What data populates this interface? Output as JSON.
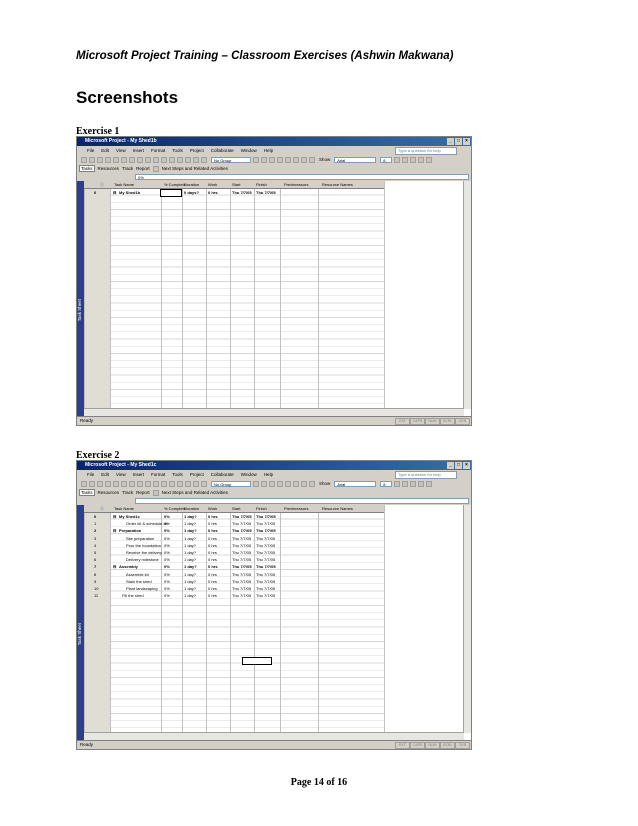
{
  "doc": {
    "header": "Microsoft Project Training – Classroom Exercises (Ashwin Makwana)",
    "heading": "Screenshots",
    "footer": "Page 14 of 16"
  },
  "exercises": [
    {
      "label": "Exercise 1",
      "window_title": "Microsoft Project - My Shed1b",
      "entry_value": "0%",
      "rows": [
        {
          "id": "0",
          "name": "My Shed1b",
          "complete": "0%",
          "duration": "0 days?",
          "work": "0 hrs",
          "start": "Thu 7/7/05",
          "finish": "Thu 7/7/05",
          "bold": true,
          "indent": 0
        }
      ]
    },
    {
      "label": "Exercise 2",
      "window_title": "Microsoft Project - My Shed1c",
      "entry_value": "",
      "rows": [
        {
          "id": "0",
          "name": "My Shed1c",
          "complete": "0%",
          "duration": "1 day?",
          "work": "0 hrs",
          "start": "Thu 7/7/05",
          "finish": "Thu 7/7/05",
          "bold": true,
          "indent": 0
        },
        {
          "id": "1",
          "name": "Order kit & schedule de",
          "complete": "0%",
          "duration": "1 day?",
          "work": "0 hrs",
          "start": "Thu 7/7/05",
          "finish": "Thu 7/7/05",
          "bold": false,
          "indent": 1
        },
        {
          "id": "2",
          "name": "Preparation",
          "complete": "0%",
          "duration": "1 day?",
          "work": "0 hrs",
          "start": "Thu 7/7/05",
          "finish": "Thu 7/7/05",
          "bold": true,
          "indent": 0
        },
        {
          "id": "3",
          "name": "Site preparation",
          "complete": "0%",
          "duration": "1 day?",
          "work": "0 hrs",
          "start": "Thu 7/7/05",
          "finish": "Thu 7/7/05",
          "bold": false,
          "indent": 1
        },
        {
          "id": "4",
          "name": "Pour the foundation",
          "complete": "0%",
          "duration": "1 day?",
          "work": "0 hrs",
          "start": "Thu 7/7/05",
          "finish": "Thu 7/7/05",
          "bold": false,
          "indent": 1
        },
        {
          "id": "5",
          "name": "Receive the delivery",
          "complete": "0%",
          "duration": "1 day?",
          "work": "0 hrs",
          "start": "Thu 7/7/05",
          "finish": "Thu 7/7/05",
          "bold": false,
          "indent": 1
        },
        {
          "id": "6",
          "name": "Delivery milestone",
          "complete": "0%",
          "duration": "1 day?",
          "work": "0 hrs",
          "start": "Thu 7/7/05",
          "finish": "Thu 7/7/05",
          "bold": false,
          "indent": 1
        },
        {
          "id": "7",
          "name": "Assembly",
          "complete": "0%",
          "duration": "1 day?",
          "work": "0 hrs",
          "start": "Thu 7/7/05",
          "finish": "Thu 7/7/05",
          "bold": true,
          "indent": 0
        },
        {
          "id": "8",
          "name": "Assemble kit",
          "complete": "0%",
          "duration": "1 day?",
          "work": "0 hrs",
          "start": "Thu 7/7/05",
          "finish": "Thu 7/7/05",
          "bold": false,
          "indent": 1
        },
        {
          "id": "9",
          "name": "Stain the shed",
          "complete": "0%",
          "duration": "1 day?",
          "work": "0 hrs",
          "start": "Thu 7/7/05",
          "finish": "Thu 7/7/05",
          "bold": false,
          "indent": 1
        },
        {
          "id": "10",
          "name": "Plant landscaping",
          "complete": "0%",
          "duration": "1 day?",
          "work": "0 hrs",
          "start": "Thu 7/7/05",
          "finish": "Thu 7/7/05",
          "bold": false,
          "indent": 1
        },
        {
          "id": "11",
          "name": "Fill the shed",
          "complete": "0%",
          "duration": "1 day?",
          "work": "0 hrs",
          "start": "Thu 7/7/05",
          "finish": "Thu 7/7/05",
          "bold": false,
          "indent": 0
        }
      ]
    }
  ],
  "ui": {
    "menu": [
      "File",
      "Edit",
      "View",
      "Insert",
      "Format",
      "Tools",
      "Project",
      "Collaborate",
      "Window",
      "Help"
    ],
    "help_placeholder": "Type a question for help",
    "group_value": "No Group",
    "show_label": "Show",
    "font_value": "Arial",
    "size_value": "8",
    "view_tabs": [
      "Tasks",
      "Resources",
      "Track",
      "Report"
    ],
    "next_steps": "Next Steps and Related Activities",
    "columns": [
      "Task Name",
      "% Complete",
      "Duration",
      "Work",
      "Start",
      "Finish",
      "Predecessors",
      "Resource Names"
    ],
    "sidebar_label": "Task Sheet",
    "status": "Ready",
    "indicators": [
      "EXT",
      "CAPS",
      "NUM",
      "SCRL",
      "OVR"
    ]
  }
}
